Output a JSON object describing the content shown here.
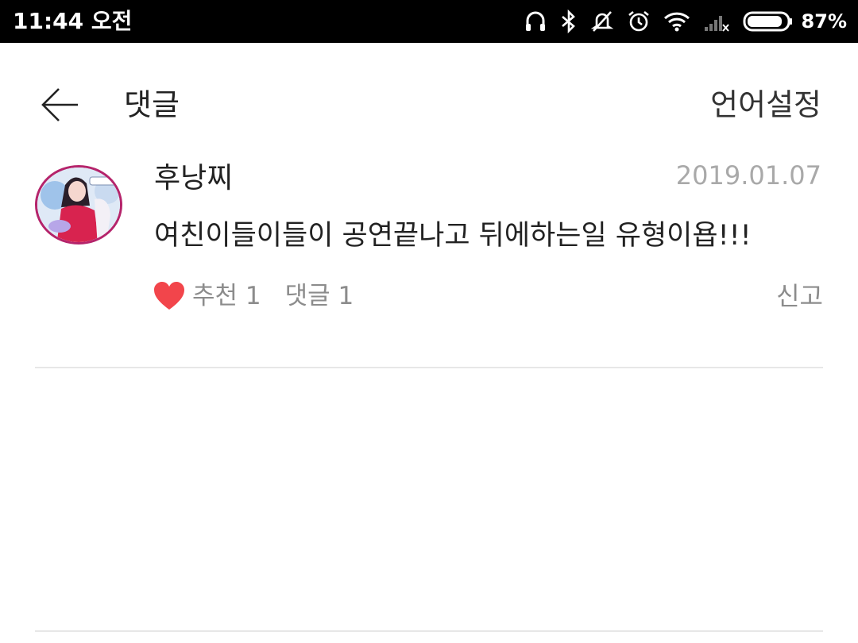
{
  "status_bar": {
    "time": "11:44 오전",
    "battery_percent": "87%",
    "icons": [
      "headset-icon",
      "bluetooth-icon",
      "silent-icon",
      "alarm-icon",
      "wifi-icon",
      "signal-icon",
      "battery-icon"
    ]
  },
  "header": {
    "title": "댓글",
    "language_settings": "언어설정",
    "back_icon": "arrow-left-icon"
  },
  "comment": {
    "username": "후낭찌",
    "date": "2019.01.07",
    "text": "여친이들이들이 공연끝나고 뒤에하는일 유형이욥!!!",
    "like_label": "추천 1",
    "reply_label": "댓글 1",
    "report_label": "신고",
    "heart_color": "#f2454b"
  },
  "colors": {
    "status_bar_bg": "#000000",
    "avatar_border": "#b5246b",
    "secondary_text": "#8c8c8c",
    "date_text": "#a9a9a9",
    "divider": "#e7e7e7"
  }
}
